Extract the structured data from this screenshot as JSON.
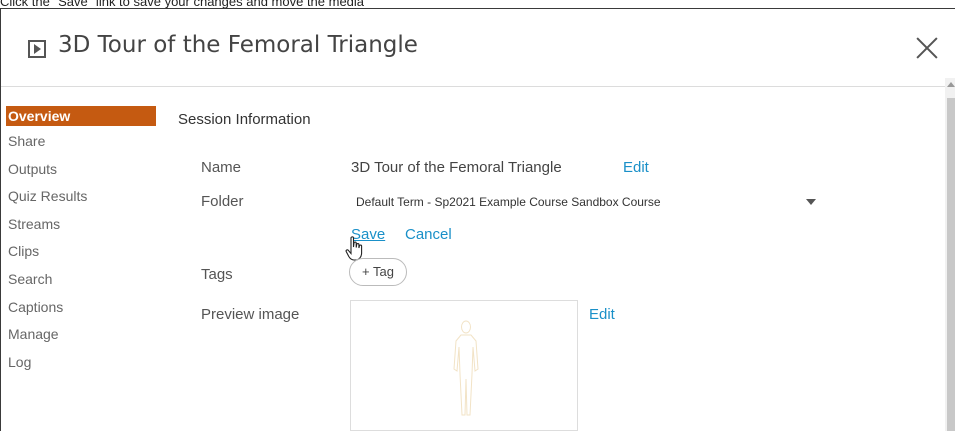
{
  "instruction": "Click the \"Save\" link to save your changes and move the media",
  "dialog": {
    "title": "3D Tour of the Femoral Triangle",
    "icons": {
      "title_icon": "play-icon",
      "close": "close-icon"
    }
  },
  "sidebar": {
    "items": [
      {
        "label": "Overview",
        "active": true
      },
      {
        "label": "Share"
      },
      {
        "label": "Outputs"
      },
      {
        "label": "Quiz Results"
      },
      {
        "label": "Streams"
      },
      {
        "label": "Clips"
      },
      {
        "label": "Search"
      },
      {
        "label": "Captions"
      },
      {
        "label": "Manage"
      },
      {
        "label": "Log"
      }
    ],
    "active_color": "#c55a11"
  },
  "session": {
    "section_title": "Session Information",
    "name_label": "Name",
    "name_value": "3D Tour of the Femoral Triangle",
    "name_edit": "Edit",
    "folder_label": "Folder",
    "folder_value": "Default Term - Sp2021 Example Course Sandbox Course",
    "save_label": "Save",
    "cancel_label": "Cancel",
    "tags_label": "Tags",
    "tag_button": "+ Tag",
    "preview_label": "Preview image",
    "preview_edit": "Edit"
  },
  "colors": {
    "link": "#1a90c8"
  }
}
